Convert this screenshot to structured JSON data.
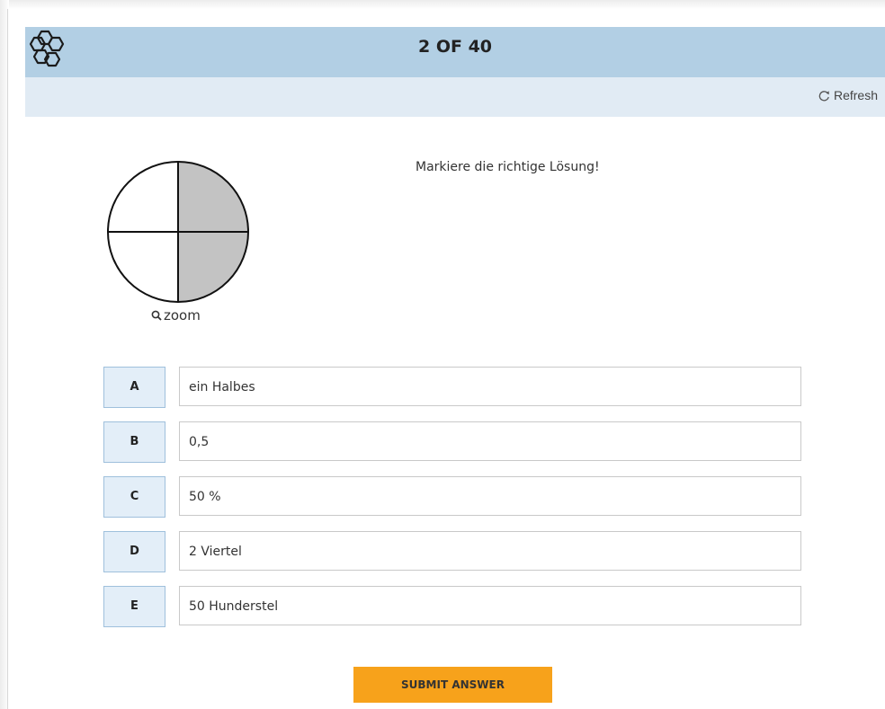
{
  "header": {
    "logo_icon": "hexagon-molecule-icon",
    "counter": "2 OF 40",
    "background": "#b2cfe4"
  },
  "toolbar": {
    "refresh_icon": "refresh-icon",
    "refresh_label": "Refresh",
    "background": "#e1ebf4"
  },
  "question": {
    "image": {
      "description_icon": "pie-quarters",
      "quarters_shaded": 2,
      "quarters_total": 4,
      "shade_color": "#c3c3c3"
    },
    "zoom_icon": "magnifier-icon",
    "zoom_label": "zoom",
    "prompt": "Markiere die richtige Lösung!"
  },
  "options": [
    {
      "letter": "A",
      "text": "ein Halbes"
    },
    {
      "letter": "B",
      "text": "0,5"
    },
    {
      "letter": "C",
      "text": "50 %"
    },
    {
      "letter": "D",
      "text": "2 Viertel"
    },
    {
      "letter": "E",
      "text": "50 Hunderstel"
    }
  ],
  "submit": {
    "label": "SUBMIT ANSWER",
    "color": "#f7a21b"
  }
}
